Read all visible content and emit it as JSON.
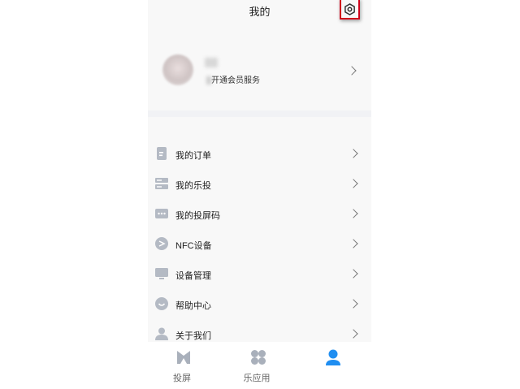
{
  "header": {
    "title": "我的"
  },
  "settings": {
    "icon": "gear-icon"
  },
  "profile": {
    "vip_text": "开通会员服务",
    "avatar_icon": "avatar"
  },
  "menu": {
    "items": [
      {
        "label": "我的订单",
        "icon": "order-icon"
      },
      {
        "label": "我的乐投",
        "icon": "server-icon"
      },
      {
        "label": "我的投屏码",
        "icon": "dots-code-icon"
      },
      {
        "label": "NFC设备",
        "icon": "nfc-icon"
      },
      {
        "label": "设备管理",
        "icon": "monitor-icon"
      },
      {
        "label": "帮助中心",
        "icon": "help-face-icon"
      },
      {
        "label": "关于我们",
        "icon": "person-icon"
      }
    ]
  },
  "tabbar": {
    "tabs": [
      {
        "label": "投屏",
        "icon": "cast-icon",
        "active": false
      },
      {
        "label": "乐应用",
        "icon": "apps-icon",
        "active": false
      },
      {
        "label": "",
        "icon": "user-icon",
        "active": true
      }
    ]
  },
  "colors": {
    "icon_gray": "#b4bac4",
    "active_blue": "#1f8ef1",
    "highlight_red": "#d0021b"
  }
}
